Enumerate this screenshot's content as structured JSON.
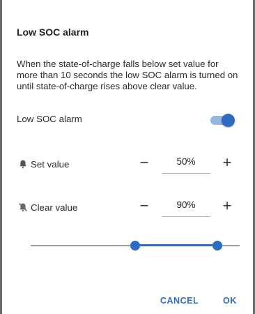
{
  "dialog": {
    "title": "Low SOC alarm",
    "description": "When the state-of-charge falls below set value for more than 10 seconds the low SOC alarm is turned on until state-of-charge rises above clear value.",
    "toggle": {
      "label": "Low SOC alarm",
      "on": true
    },
    "set_value": {
      "label": "Set value",
      "value": "50%",
      "icon": "bell-icon",
      "minus": "−",
      "plus": "+"
    },
    "clear_value": {
      "label": "Clear value",
      "value": "90%",
      "icon": "bell-off-icon",
      "minus": "−",
      "plus": "+"
    },
    "slider": {
      "min": 0,
      "max": 100,
      "low": 50,
      "high": 90
    },
    "buttons": {
      "cancel": "CANCEL",
      "ok": "OK"
    }
  },
  "colors": {
    "accent": "#2d6cc4",
    "toggle_track": "#95b6e0",
    "rail": "#9e9e9e",
    "frame": "#6d6d6d"
  }
}
